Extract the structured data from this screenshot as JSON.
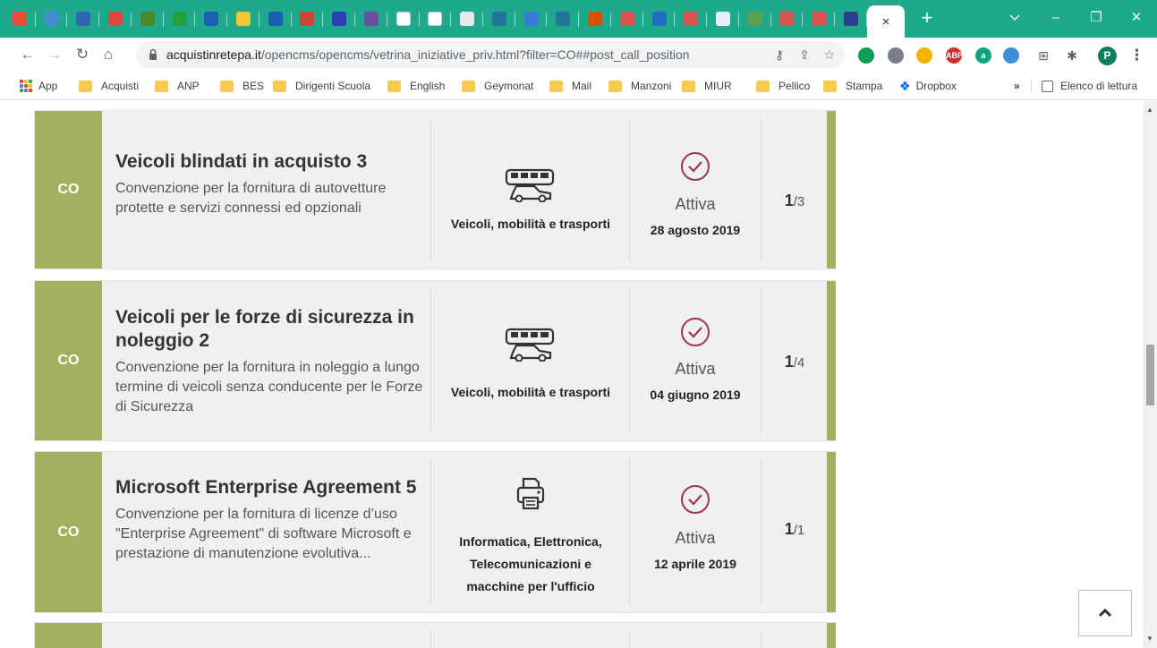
{
  "browser": {
    "active_tab_close": "×",
    "new_tab": "+",
    "window_controls": {
      "minimize": "–",
      "restore": "❐",
      "close": "✕"
    },
    "url_host": "acquistinretepa.it",
    "url_path": "/opencms/opencms/vetrina_iniziative_priv.html?filter=CO##post_call_position",
    "profile_initial": "P",
    "pinned_tab_colors": [
      "#e84c3d",
      "#3e8ed0",
      "#2f64b9",
      "#d9493c",
      "#4a8a2c",
      "#24a13b",
      "#1d5fb3",
      "#f3c531",
      "#1a5eb0",
      "#cc4433",
      "#2b3fb5",
      "#6d4fa0",
      "#ffffff",
      "#ffffff",
      "#e8e8e8",
      "#21759b",
      "#3a7bd5",
      "#21759b",
      "#d35400",
      "#d9534f",
      "#1d6fc4",
      "#d9534f",
      "#e8eef8",
      "#59a14f",
      "#d9534f",
      "#d9534f",
      "#2c3e8f"
    ],
    "extensions": [
      {
        "label": "",
        "color": "#0f9d58"
      },
      {
        "label": "",
        "color": "#7b8088"
      },
      {
        "label": "",
        "color": "#f5b400"
      },
      {
        "label": "ABP",
        "color": "#d32f2f"
      },
      {
        "label": "a",
        "color": "#10a37f"
      },
      {
        "label": "",
        "color": "#3b8fd9"
      }
    ]
  },
  "bookmarks": {
    "apps": "App",
    "items": [
      "Acquisti",
      "ANP",
      "BES",
      "Dirigenti Scuola",
      "English",
      "Geymonat",
      "Mail",
      "Manzoni",
      "MIUR",
      "Pellico",
      "Stampa"
    ],
    "dropbox": "Dropbox",
    "more": "»",
    "reading_list": "Elenco di lettura"
  },
  "cards": [
    {
      "badge": "CO",
      "title": "Veicoli blindati in acquisto 3",
      "desc": "Convenzione per la fornitura di autovetture protette e servizi connessi ed opzionali",
      "category": "Veicoli, mobilità e trasporti",
      "category_icon": "vehicles-icon",
      "status": "Attiva",
      "date": "28 agosto 2019",
      "lot_current": "1",
      "lot_total": "/3"
    },
    {
      "badge": "CO",
      "title": "Veicoli per le forze di sicurezza in noleggio 2",
      "desc": "Convenzione per la fornitura in noleggio a lungo termine di veicoli senza conducente per le Forze di Sicurezza",
      "category": "Veicoli, mobilità e trasporti",
      "category_icon": "vehicles-icon",
      "status": "Attiva",
      "date": "04 giugno 2019",
      "lot_current": "1",
      "lot_total": "/4"
    },
    {
      "badge": "CO",
      "title": "Microsoft Enterprise Agreement 5",
      "desc": "Convenzione per la fornitura di licenze d’uso \"Enterprise Agreement\" di software Microsoft e prestazione di manutenzione evolutiva...",
      "category": "Informatica, Elettronica, Telecomunicazioni e macchine per l'ufficio",
      "category_icon": "printer-icon",
      "status": "Attiva",
      "date": "12 aprile 2019",
      "lot_current": "1",
      "lot_total": "/1"
    }
  ],
  "theme": {
    "accent": "#a2b15f",
    "status_check": "#a3315c",
    "tabstrip": "#1ea98c"
  }
}
